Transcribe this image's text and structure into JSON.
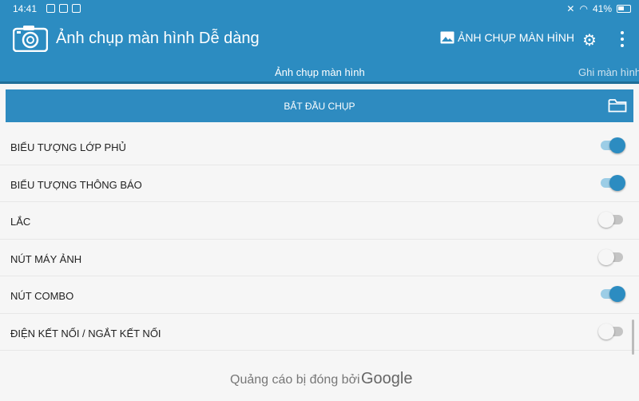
{
  "status": {
    "time": "14:41",
    "battery": "41%"
  },
  "app": {
    "title": "Ảnh chụp màn hình Dễ dàng",
    "action_label": "ẢNH CHỤP MÀN HÌNH"
  },
  "tabs": [
    {
      "label": "Ảnh chụp màn hình",
      "active": true
    },
    {
      "label": "Ghi màn hình",
      "active": false
    }
  ],
  "start_button": {
    "label": "BẮT ĐẦU CHỤP"
  },
  "settings": [
    {
      "label": "BIỂU TƯỢNG LỚP PHỦ",
      "enabled": true
    },
    {
      "label": "BIỂU TƯỢNG THÔNG BÁO",
      "enabled": true
    },
    {
      "label": "LẮC",
      "enabled": false
    },
    {
      "label": "NÚT MÁY ẢNH",
      "enabled": false
    },
    {
      "label": "NÚT COMBO",
      "enabled": true
    },
    {
      "label": "ĐIỆN KẾT NỐI / NGẮT KẾT NỐI",
      "enabled": false
    }
  ],
  "ad": {
    "text": "Quảng cáo bị đóng bởi",
    "brand": "Google"
  },
  "colors": {
    "primary": "#2c8cc1",
    "toggle_on": "#2c8cc1",
    "toggle_off": "#c4c4c4"
  }
}
